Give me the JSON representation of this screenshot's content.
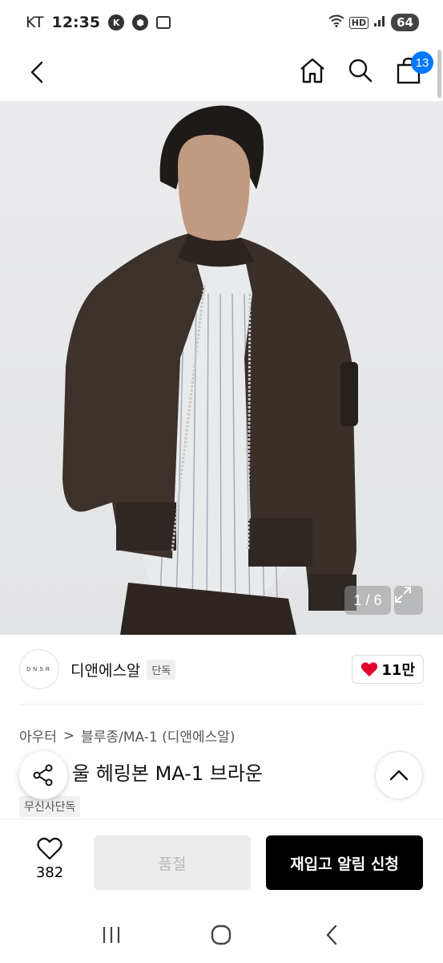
{
  "status_bar": {
    "carrier": "KT",
    "time": "12:35",
    "notif_icons": [
      "K",
      "⬢"
    ],
    "network": "HD",
    "battery": "64"
  },
  "nav": {
    "cart_count": "13"
  },
  "gallery": {
    "counter": "1 / 6"
  },
  "brand": {
    "logo_text": "DNSR",
    "name": "디앤에스알",
    "badge": "단독",
    "likes": "11만"
  },
  "product": {
    "breadcrumb": [
      "아우터",
      ">",
      "블루종/MA-1 (디앤에스알)"
    ],
    "title": "울 헤링본 MA-1 브라운",
    "tag": "무신사단독"
  },
  "bottom_bar": {
    "wish_count": "382",
    "soldout_label": "품절",
    "restock_label": "재입고 알림 신청"
  },
  "colors": {
    "accent": "#0078ff",
    "heart": "#e4002b",
    "cta": "#000000"
  }
}
